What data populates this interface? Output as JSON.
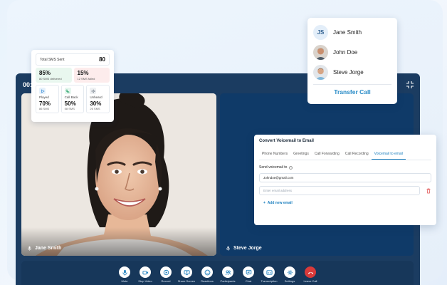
{
  "call": {
    "time": "00:"
  },
  "stats": {
    "total_label": "Total SMS Sent",
    "total_value": "80",
    "delivered_pct": "85%",
    "delivered_sub": "80 SMS delivered",
    "failed_pct": "15%",
    "failed_sub": "12 SMS failed",
    "cells": [
      {
        "label": "Played",
        "pct": "70%",
        "sub": "86 SMS",
        "icon": "play-icon",
        "color": "#3b8fd6",
        "bg": "#e6f1fb"
      },
      {
        "label": "Call Back",
        "pct": "50%",
        "sub": "58 SMS",
        "icon": "phone-icon",
        "color": "#2aa36b",
        "bg": "#e5f6ee"
      },
      {
        "label": "Unheard",
        "pct": "30%",
        "sub": "26 SMS",
        "icon": "mute-icon",
        "color": "#7d8791",
        "bg": "#eef0f2"
      }
    ]
  },
  "transfer": {
    "people": [
      {
        "name": "Jane Smith",
        "initials": "JS"
      },
      {
        "name": "John Doe"
      },
      {
        "name": "Steve Jorge"
      }
    ],
    "button": "Transfer Call"
  },
  "voicemail": {
    "title": "Convert Voicemail to Email",
    "tabs": [
      "Phone Numbers",
      "Greetings",
      "Call Forwarding",
      "Call Recording",
      "Voicemail to email"
    ],
    "send_label": "Send voicemail to",
    "email_value": "Johndoe@gmail.com",
    "email_placeholder": "Enter email address",
    "add_label": "Add new email"
  },
  "tiles": {
    "left_name": "Jane Smith",
    "right_name": "Steve Jorge"
  },
  "controls": [
    {
      "label": "Mute",
      "icon": "mic-icon"
    },
    {
      "label": "Stop Video",
      "icon": "video-icon"
    },
    {
      "label": "Record",
      "icon": "record-icon"
    },
    {
      "label": "Share Screen",
      "icon": "screen-share-icon"
    },
    {
      "label": "Reactions",
      "icon": "smiley-icon"
    },
    {
      "label": "Participants",
      "icon": "participants-icon"
    },
    {
      "label": "Chat",
      "icon": "chat-icon"
    },
    {
      "label": "Transcription",
      "icon": "transcription-icon"
    },
    {
      "label": "Settings",
      "icon": "gear-icon"
    },
    {
      "label": "Leave Call",
      "icon": "hangup-icon"
    }
  ]
}
